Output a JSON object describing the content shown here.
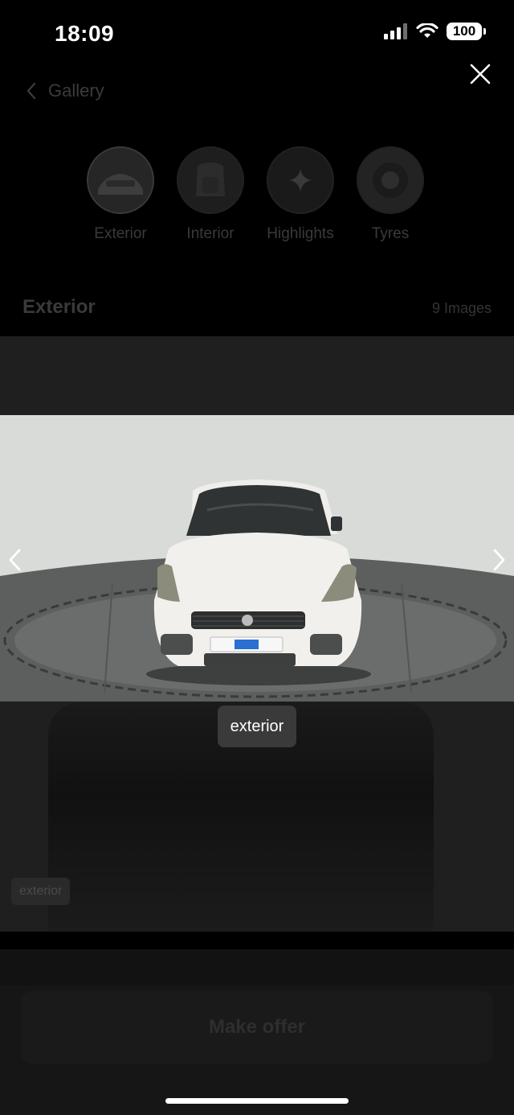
{
  "status_bar": {
    "time": "18:09",
    "battery": "100",
    "icons": [
      "signal-icon",
      "wifi-icon",
      "battery-icon"
    ]
  },
  "header": {
    "back_label": "Gallery"
  },
  "categories": [
    {
      "label": "Exterior",
      "icon": "car-exterior-thumbnail"
    },
    {
      "label": "Interior",
      "icon": "car-interior-thumbnail"
    },
    {
      "label": "Highlights",
      "icon": "sparkle-icon"
    },
    {
      "label": "Tyres",
      "icon": "tyre-thumbnail"
    }
  ],
  "section": {
    "title": "Exterior",
    "count": "9 Images"
  },
  "lightbox": {
    "caption": "exterior",
    "background_caption": "exterior"
  },
  "footer": {
    "offer_label": "Make offer"
  },
  "colors": {
    "background": "#000000",
    "overlay_dim": "#1f1f1f",
    "caption_chip": "#3a3a3a",
    "car_body": "#f2f0ec"
  }
}
